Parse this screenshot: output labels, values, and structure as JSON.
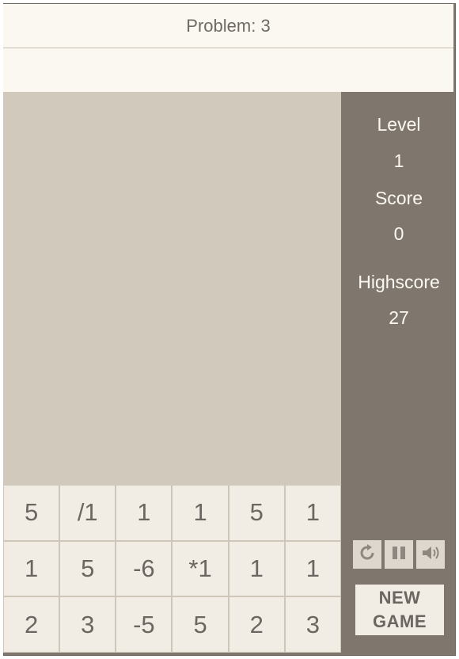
{
  "header": {
    "problem_label": "Problem: 3",
    "answer_value": ""
  },
  "sidebar": {
    "level_label": "Level",
    "level_value": "1",
    "score_label": "Score",
    "score_value": "0",
    "highscore_label": "Highscore",
    "highscore_value": "27"
  },
  "grid": {
    "cells": [
      [
        "5",
        "/1",
        "1",
        "1",
        "5",
        "1"
      ],
      [
        "1",
        "5",
        "-6",
        "*1",
        "1",
        "1"
      ],
      [
        "2",
        "3",
        "-5",
        "5",
        "2",
        "3"
      ]
    ]
  },
  "controls": {
    "icons": [
      "restart-icon",
      "pause-icon",
      "sound-icon"
    ]
  },
  "new_game": {
    "line1": "NEW",
    "line2": "GAME"
  },
  "colors": {
    "frame": "#7f766d",
    "panel_light": "#fbf8f2",
    "playfield": "#d2c9bd",
    "cell": "#f2ede4",
    "cell_text": "#6b6661"
  }
}
